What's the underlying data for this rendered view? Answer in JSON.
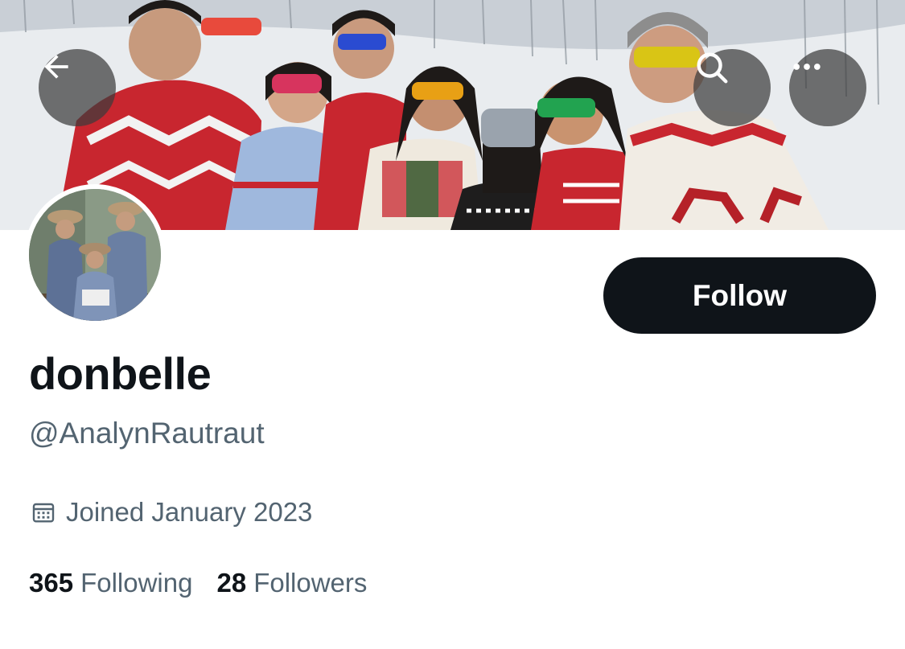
{
  "profile": {
    "display_name": "donbelle",
    "handle": "@AnalynRautraut",
    "joined": "Joined January 2023",
    "following_count": "365",
    "following_label": "Following",
    "followers_count": "28",
    "followers_label": "Followers"
  },
  "actions": {
    "follow_label": "Follow"
  },
  "icons": {
    "back": "arrow-left-icon",
    "search": "search-icon",
    "more": "more-dots-icon",
    "calendar": "calendar-icon"
  },
  "colors": {
    "follow_bg": "#0f1419",
    "secondary_text": "#536471",
    "primary_text": "#0f1419"
  }
}
